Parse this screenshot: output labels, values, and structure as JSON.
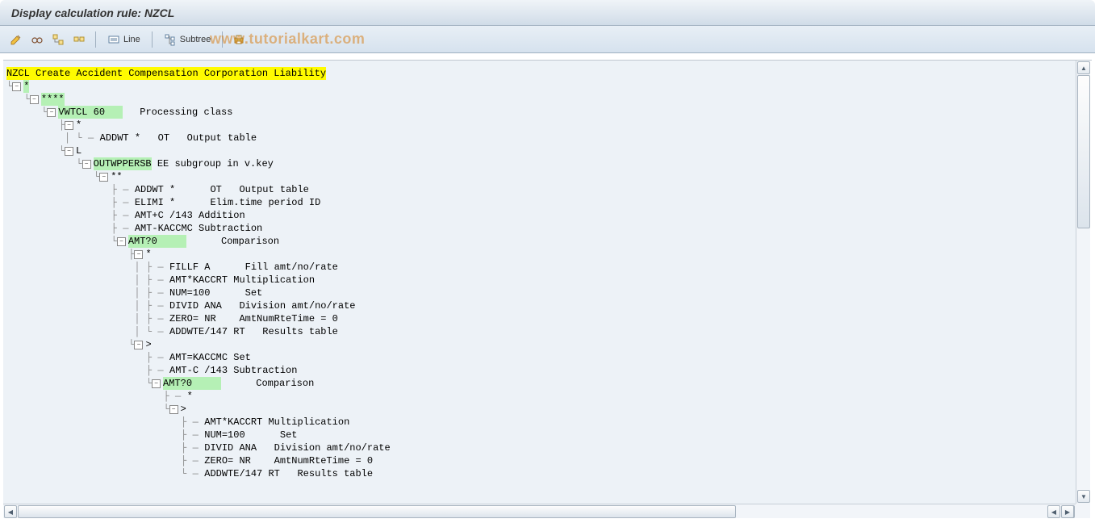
{
  "title": "Display calculation rule: NZCL",
  "toolbar": {
    "line_label": "Line",
    "subtree_label": "Subtree"
  },
  "watermark": "www.tutorialkart.com",
  "root": {
    "code": "NZCL",
    "desc": " Create Accident Compensation Corporation Liability"
  },
  "tree": [
    {
      "d": 0,
      "t": "branch",
      "last": true,
      "lbl": "*",
      "hl": "green"
    },
    {
      "d": 1,
      "t": "branch",
      "last": true,
      "lbl": "****",
      "hl": "green"
    },
    {
      "d": 2,
      "t": "branch",
      "last": true,
      "code": "VWTCL 60",
      "desc": "   Processing class",
      "hl": "green",
      "codePad": 11
    },
    {
      "d": 3,
      "t": "branch",
      "last": false,
      "lbl": "*"
    },
    {
      "d": 4,
      "t": "leaf",
      "last": true,
      "p": [
        false,
        false,
        false,
        false
      ],
      "code": "ADDWT *",
      "desc": "   OT   Output table"
    },
    {
      "d": 3,
      "t": "branch",
      "last": true,
      "lbl": "L"
    },
    {
      "d": 4,
      "t": "branch",
      "last": true,
      "code": "OUTWPPERSB",
      "desc": " EE subgroup in v.key",
      "hl": "green",
      "codePad": 10
    },
    {
      "d": 5,
      "t": "branch",
      "last": true,
      "lbl": "**"
    },
    {
      "d": 6,
      "t": "leaf",
      "last": false,
      "p": [
        false,
        false,
        false,
        false,
        false,
        false
      ],
      "code": "ADDWT *",
      "desc": "   OT   Output table",
      "codePad": 10
    },
    {
      "d": 6,
      "t": "leaf",
      "last": false,
      "p": [
        false,
        false,
        false,
        false,
        false,
        false
      ],
      "code": "ELIMI *",
      "desc": "   Elim.time period ID",
      "codePad": 10
    },
    {
      "d": 6,
      "t": "leaf",
      "last": false,
      "p": [
        false,
        false,
        false,
        false,
        false,
        false
      ],
      "code": "AMT+C /143",
      "desc": " Addition",
      "codePad": 10
    },
    {
      "d": 6,
      "t": "leaf",
      "last": false,
      "p": [
        false,
        false,
        false,
        false,
        false,
        false
      ],
      "code": "AMT-KACCMC",
      "desc": " Subtraction",
      "codePad": 10
    },
    {
      "d": 6,
      "t": "branch",
      "last": true,
      "code": "AMT?0",
      "desc": "      Comparison",
      "hl": "green",
      "codePad": 10
    },
    {
      "d": 7,
      "t": "branch",
      "last": false,
      "lbl": "*"
    },
    {
      "d": 8,
      "t": "leaf",
      "last": false,
      "p": [
        false,
        false,
        false,
        false,
        false,
        false,
        false,
        false
      ],
      "code": "FILLF A",
      "desc": "   Fill amt/no/rate",
      "codePad": 10
    },
    {
      "d": 8,
      "t": "leaf",
      "last": false,
      "p": [
        false,
        false,
        false,
        false,
        false,
        false,
        false,
        false
      ],
      "code": "AMT*KACCRT",
      "desc": " Multiplication",
      "codePad": 10
    },
    {
      "d": 8,
      "t": "leaf",
      "last": false,
      "p": [
        false,
        false,
        false,
        false,
        false,
        false,
        false,
        false
      ],
      "code": "NUM=100",
      "desc": "   Set",
      "codePad": 10
    },
    {
      "d": 8,
      "t": "leaf",
      "last": false,
      "p": [
        false,
        false,
        false,
        false,
        false,
        false,
        false,
        false
      ],
      "code": "DIVID ANA",
      "desc": "  Division amt/no/rate",
      "codePad": 10
    },
    {
      "d": 8,
      "t": "leaf",
      "last": false,
      "p": [
        false,
        false,
        false,
        false,
        false,
        false,
        false,
        false
      ],
      "code": "ZERO= NR",
      "desc": "  AmtNumRteTime = 0",
      "codePad": 10
    },
    {
      "d": 8,
      "t": "leaf",
      "last": true,
      "p": [
        false,
        false,
        false,
        false,
        false,
        false,
        false,
        false
      ],
      "code": "ADDWTE/147",
      "desc": " RT   Results table",
      "codePad": 10
    },
    {
      "d": 7,
      "t": "branch",
      "last": true,
      "lbl": ">"
    },
    {
      "d": 8,
      "t": "leaf",
      "last": false,
      "p": [
        false,
        false,
        false,
        false,
        false,
        false,
        false,
        false
      ],
      "code": "AMT=KACCMC",
      "desc": " Set",
      "codePad": 10
    },
    {
      "d": 8,
      "t": "leaf",
      "last": false,
      "p": [
        false,
        false,
        false,
        false,
        false,
        false,
        false,
        false
      ],
      "code": "AMT-C /143",
      "desc": " Subtraction",
      "codePad": 10
    },
    {
      "d": 8,
      "t": "branch",
      "last": true,
      "code": "AMT?0",
      "desc": "      Comparison",
      "hl": "green",
      "codePad": 10
    },
    {
      "d": 9,
      "t": "leaf",
      "last": false,
      "p": [
        false,
        false,
        false,
        false,
        false,
        false,
        false,
        false,
        false
      ],
      "lbl": "*"
    },
    {
      "d": 9,
      "t": "branch",
      "last": true,
      "lbl": ">"
    },
    {
      "d": 10,
      "t": "leaf",
      "last": false,
      "p": [
        false,
        false,
        false,
        false,
        false,
        false,
        false,
        false,
        false,
        false
      ],
      "code": "AMT*KACCRT",
      "desc": " Multiplication",
      "codePad": 10
    },
    {
      "d": 10,
      "t": "leaf",
      "last": false,
      "p": [
        false,
        false,
        false,
        false,
        false,
        false,
        false,
        false,
        false,
        false
      ],
      "code": "NUM=100",
      "desc": "   Set",
      "codePad": 10
    },
    {
      "d": 10,
      "t": "leaf",
      "last": false,
      "p": [
        false,
        false,
        false,
        false,
        false,
        false,
        false,
        false,
        false,
        false
      ],
      "code": "DIVID ANA",
      "desc": "  Division amt/no/rate",
      "codePad": 10
    },
    {
      "d": 10,
      "t": "leaf",
      "last": false,
      "p": [
        false,
        false,
        false,
        false,
        false,
        false,
        false,
        false,
        false,
        false
      ],
      "code": "ZERO= NR",
      "desc": "  AmtNumRteTime = 0",
      "codePad": 10
    },
    {
      "d": 10,
      "t": "leaf",
      "last": true,
      "p": [
        false,
        false,
        false,
        false,
        false,
        false,
        false,
        false,
        false,
        false
      ],
      "code": "ADDWTE/147",
      "desc": " RT   Results table",
      "codePad": 10
    }
  ]
}
